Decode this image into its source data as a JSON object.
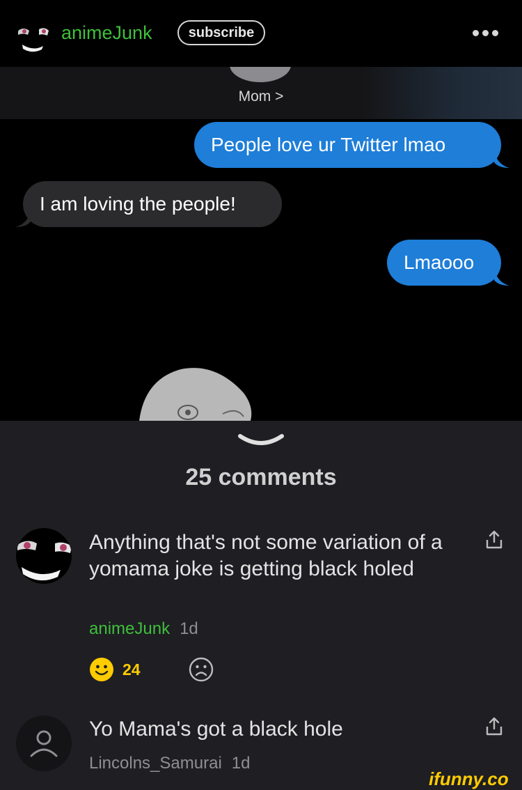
{
  "header": {
    "channel_name": "animeJunk",
    "subscribe_label": "subscribe",
    "more_icon": "more-dots-icon"
  },
  "post": {
    "contact_name": "Mom >",
    "messages": [
      {
        "side": "sent",
        "text": "People love ur Twitter lmao"
      },
      {
        "side": "received",
        "text": "I am loving the people!"
      },
      {
        "side": "sent",
        "text": "Lmaooo"
      }
    ]
  },
  "comments_section": {
    "count_label": "25 comments",
    "comments": [
      {
        "text": "Anything that's not some variation of a yomama joke is getting black holed",
        "username": "animeJunk",
        "age": "1d",
        "smile_count": "24"
      },
      {
        "text": "Yo Mama's got a black hole",
        "username": "Lincolns_Samurai",
        "age": "1d"
      }
    ]
  },
  "watermark": "ifunny.co",
  "colors": {
    "accent_green": "#3fbf3a",
    "imessage_blue": "#1e7ed8",
    "smile_yellow": "#ffcc00",
    "background": "#1e1e23"
  }
}
